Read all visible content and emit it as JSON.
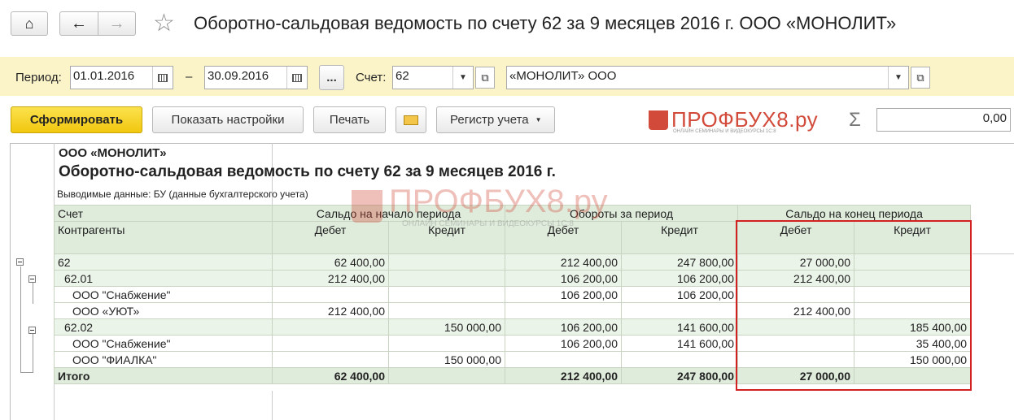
{
  "window": {
    "title": "Оборотно-сальдовая ведомость по счету 62 за 9 месяцев 2016 г. ООО «МОНОЛИТ»"
  },
  "filters": {
    "period_label": "Период:",
    "date_from": "01.01.2016",
    "dash": "–",
    "date_to": "30.09.2016",
    "more_label": "...",
    "account_label": "Счет:",
    "account_value": "62",
    "org_value": "«МОНОЛИТ» ООО"
  },
  "toolbar": {
    "generate_label": "Сформировать",
    "settings_label": "Показать настройки",
    "print_label": "Печать",
    "register_label": "Регистр учета",
    "sum_symbol": "Σ",
    "sum_value": "0,00"
  },
  "watermark": {
    "brand": "ПРОФБУХ8.ру",
    "tagline": "ОНЛАЙН СЕМИНАРЫ И ВИДЕОКУРСЫ 1С:8"
  },
  "report": {
    "org": "ООО «МОНОЛИТ»",
    "title": "Оборотно-сальдовая ведомость по счету 62 за 9 месяцев 2016 г.",
    "output_data": "Выводимые данные:  БУ (данные бухгалтерского учета)",
    "headers": {
      "account": "Счет",
      "counterparties": "Контрагенты",
      "opening": "Сальдо на начало периода",
      "turnover": "Обороты за период",
      "closing": "Сальдо на конец периода",
      "debit": "Дебет",
      "credit": "Кредит"
    },
    "rows": [
      {
        "name": "62",
        "od": "62 400,00",
        "oc": "",
        "td": "212 400,00",
        "tc": "247 800,00",
        "cd": "27 000,00",
        "cc": ""
      },
      {
        "name": "62.01",
        "od": "212 400,00",
        "oc": "",
        "td": "106 200,00",
        "tc": "106 200,00",
        "cd": "212 400,00",
        "cc": ""
      },
      {
        "name": "ООО \"Снабжение\"",
        "od": "",
        "oc": "",
        "td": "106 200,00",
        "tc": "106 200,00",
        "cd": "",
        "cc": ""
      },
      {
        "name": "ООО «УЮТ»",
        "od": "212 400,00",
        "oc": "",
        "td": "",
        "tc": "",
        "cd": "212 400,00",
        "cc": ""
      },
      {
        "name": "62.02",
        "od": "",
        "oc": "150 000,00",
        "td": "106 200,00",
        "tc": "141 600,00",
        "cd": "",
        "cc": "185 400,00"
      },
      {
        "name": "ООО \"Снабжение\"",
        "od": "",
        "oc": "",
        "td": "106 200,00",
        "tc": "141 600,00",
        "cd": "",
        "cc": "35 400,00"
      },
      {
        "name": "ООО \"ФИАЛКА\"",
        "od": "",
        "oc": "150 000,00",
        "td": "",
        "tc": "",
        "cd": "",
        "cc": "150 000,00"
      }
    ],
    "total": {
      "name": "Итого",
      "od": "62 400,00",
      "oc": "",
      "td": "212 400,00",
      "tc": "247 800,00",
      "cd": "27 000,00",
      "cc": ""
    }
  },
  "colors": {
    "filter_bar": "#fbf4c9",
    "primary_button": "#f5d21a",
    "header_bg": "#dfecdc",
    "highlight": "#d32020",
    "watermark": "#d24a3a"
  }
}
